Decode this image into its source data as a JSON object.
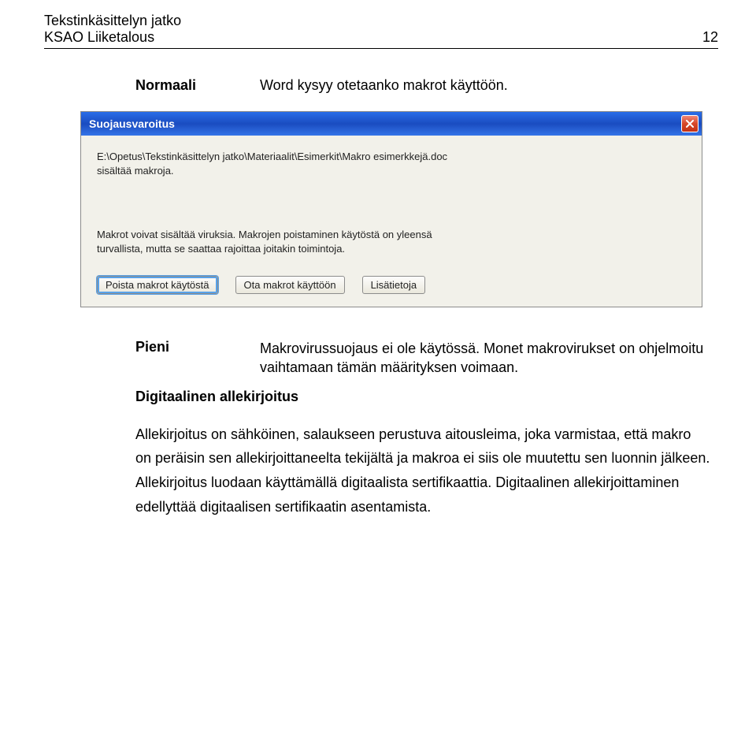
{
  "header": {
    "line1": "Tekstinkäsittelyn jatko",
    "line2": "KSAO Liiketalous",
    "pageNumber": "12"
  },
  "row1": {
    "label": "Normaali",
    "text": "Word kysyy otetaanko makrot käyttöön."
  },
  "dialog": {
    "title": "Suojausvaroitus",
    "text1a": "E:\\Opetus\\Tekstinkäsittelyn jatko\\Materiaalit\\Esimerkit\\Makro esimerkkejä.doc",
    "text1b": "sisältää makroja.",
    "text2a": "Makrot voivat sisältää viruksia. Makrojen poistaminen käytöstä on yleensä",
    "text2b": "turvallista, mutta se saattaa rajoittaa joitakin toimintoja.",
    "buttons": {
      "disable": "Poista makrot käytöstä",
      "enable": "Ota makrot käyttöön",
      "more": "Lisätietoja"
    }
  },
  "row2": {
    "label": "Pieni",
    "text": "Makrovirussuojaus ei ole käytössä. Monet makrovirukset on ohjelmoitu vaihtamaan tämän määrityksen voimaan."
  },
  "subheading": "Digitaalinen allekirjoitus",
  "paragraph": "Allekirjoitus on sähköinen, salaukseen perustuva aitousleima, joka varmistaa, että makro on peräisin sen allekirjoittaneelta tekijältä ja makroa ei siis ole muutettu sen luonnin jälkeen. Allekirjoitus luodaan käyttämällä digitaalista sertifikaattia. Digitaalinen allekirjoittaminen edellyttää digitaalisen sertifikaatin asentamista."
}
